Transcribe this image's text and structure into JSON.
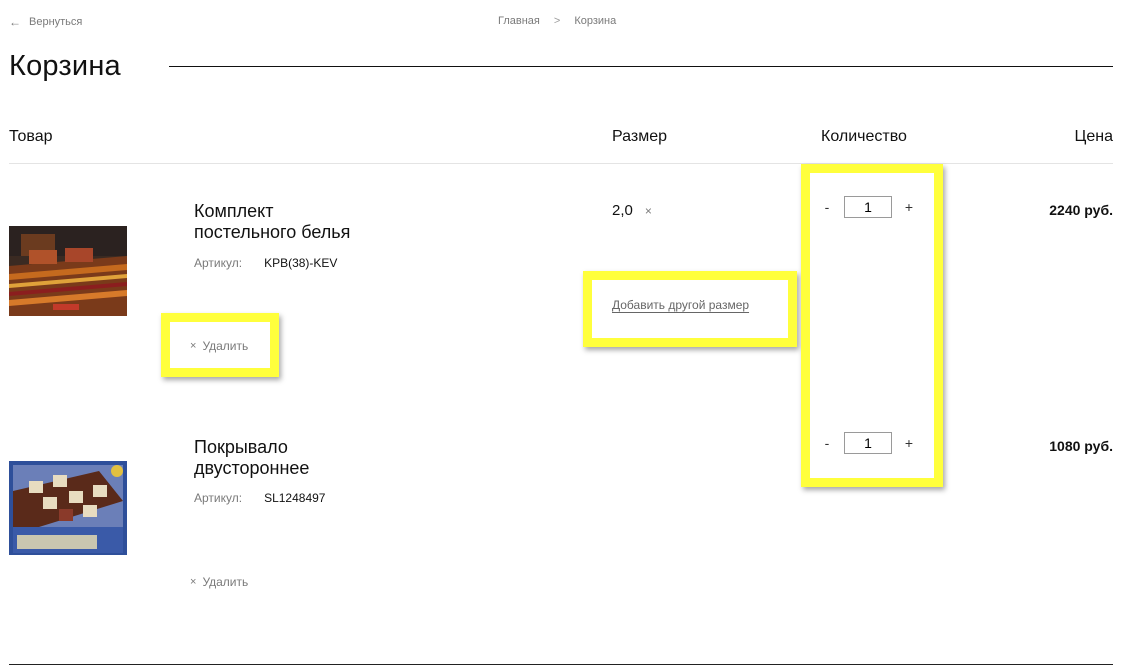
{
  "nav": {
    "back_label": "Вернуться",
    "back_icon": "arrow-left-icon"
  },
  "breadcrumb": {
    "items": [
      "Главная",
      "Корзина"
    ],
    "separator": ">"
  },
  "page": {
    "title": "Корзина"
  },
  "table": {
    "headers": {
      "product": "Товар",
      "size": "Размер",
      "quantity": "Количество",
      "price": "Цена"
    }
  },
  "items": [
    {
      "name_line1": "Комплект",
      "name_line2": "постельного белья",
      "sku_label": "Артикул:",
      "sku": "KPB(38)-KEV",
      "size": "2,0",
      "size_remove": "×",
      "add_size_label": "Добавить другой размер",
      "qty_minus": "-",
      "qty_plus": "+",
      "quantity": "1",
      "price": "2240 руб.",
      "remove_label": "Удалить",
      "remove_icon": "×"
    },
    {
      "name_line1": "Покрывало",
      "name_line2": "двустороннее",
      "sku_label": "Артикул:",
      "sku": "SL1248497",
      "qty_minus": "-",
      "qty_plus": "+",
      "quantity": "1",
      "price": "1080 руб.",
      "remove_label": "Удалить",
      "remove_icon": "×"
    }
  ],
  "colors": {
    "highlight": "#ffff3c",
    "text": "#111111",
    "muted": "#7a7a7a"
  }
}
